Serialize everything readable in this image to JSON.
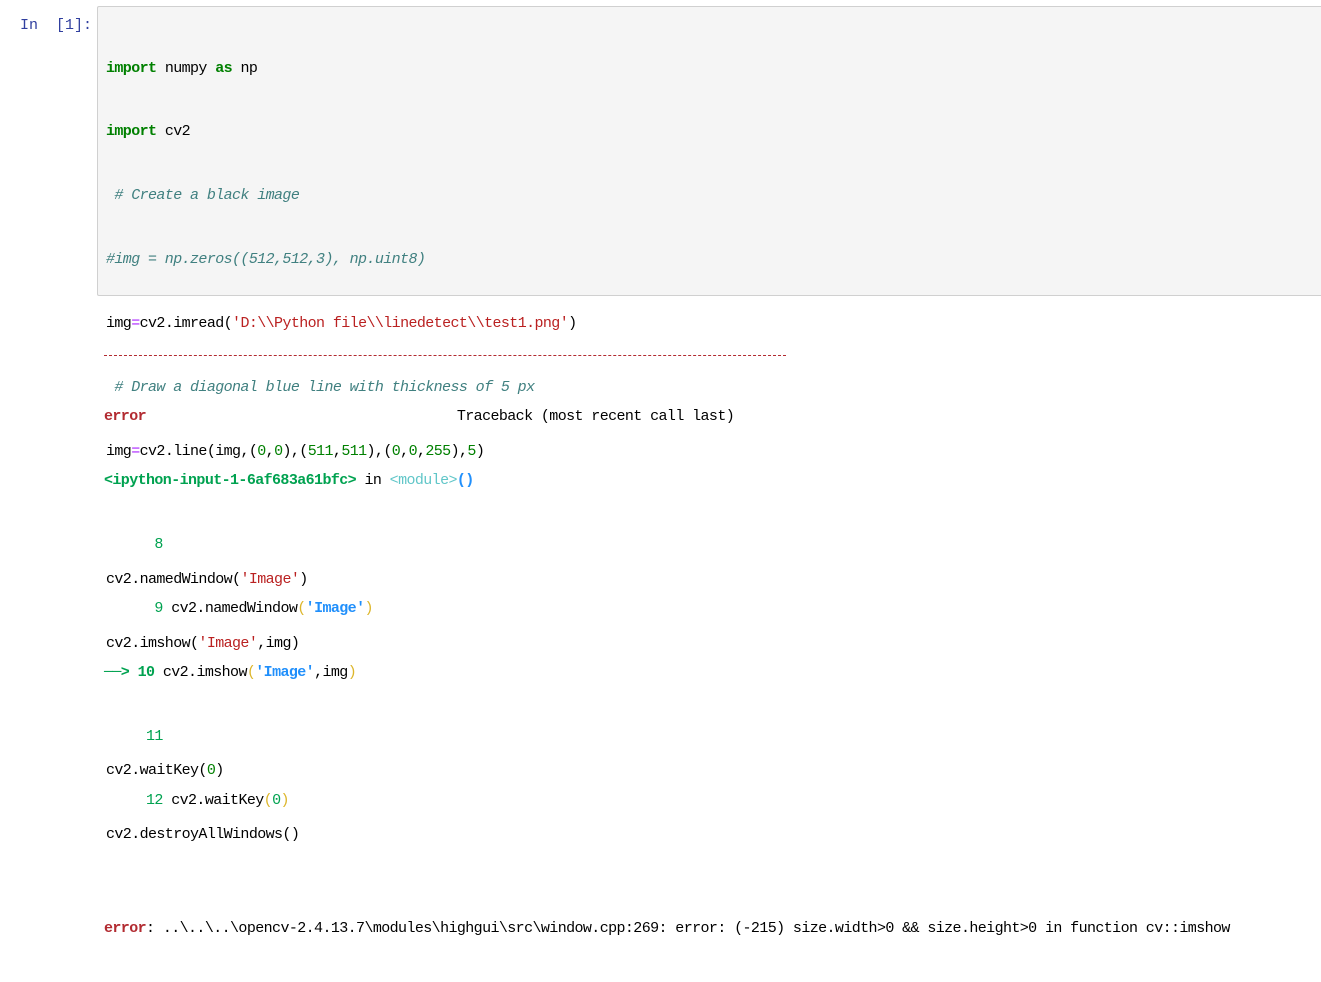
{
  "cell": {
    "prompt": "In  [1]:",
    "code_lines": [
      "import numpy as np",
      "import cv2",
      " # Create a black image",
      "#img = np.zeros((512,512,3), np.uint8)",
      "img=cv2.imread('D:\\\\Python file\\\\linedetect\\\\test1.png')",
      " # Draw a diagonal blue line with thickness of 5 px",
      "img=cv2.line(img,(0,0),(511,511),(0,0,255),5)",
      "",
      "cv2.namedWindow('Image')",
      "cv2.imshow('Image',img)",
      "",
      "cv2.waitKey(0)",
      "cv2.destroyAllWindows()"
    ]
  },
  "output": {
    "error_name": "error",
    "traceback_header": "Traceback (most recent call last)",
    "input_ref": "<ipython-input-1-6af683a61bfc>",
    "input_ref_in": "in",
    "module_ref": "<module>",
    "module_parens": "()",
    "arrow": "--->",
    "tb_lines": [
      {
        "num": "8",
        "text": ""
      },
      {
        "num": "9",
        "text": "cv2.namedWindow('Image')"
      },
      {
        "num": "10",
        "text": "cv2.imshow('Image',img)",
        "current": true
      },
      {
        "num": "11",
        "text": ""
      },
      {
        "num": "12",
        "text": "cv2.waitKey(0)"
      }
    ],
    "final_error_label": "error",
    "final_error_message": ": ..\\..\\..\\opencv-2.4.13.7\\modules\\highgui\\src\\window.cpp:269: error: (-215) size.width>0 && size.height>0 in function cv::imshow"
  },
  "colors": {
    "prompt": "#303f9f",
    "keyword": "#008000",
    "comment": "#408080",
    "string": "#ba2121",
    "error": "#b22b31",
    "traceback_green": "#00a250",
    "traceback_cyan": "#60c6c8",
    "traceback_blue": "#208ffb",
    "input_background": "#f5f5f5"
  }
}
